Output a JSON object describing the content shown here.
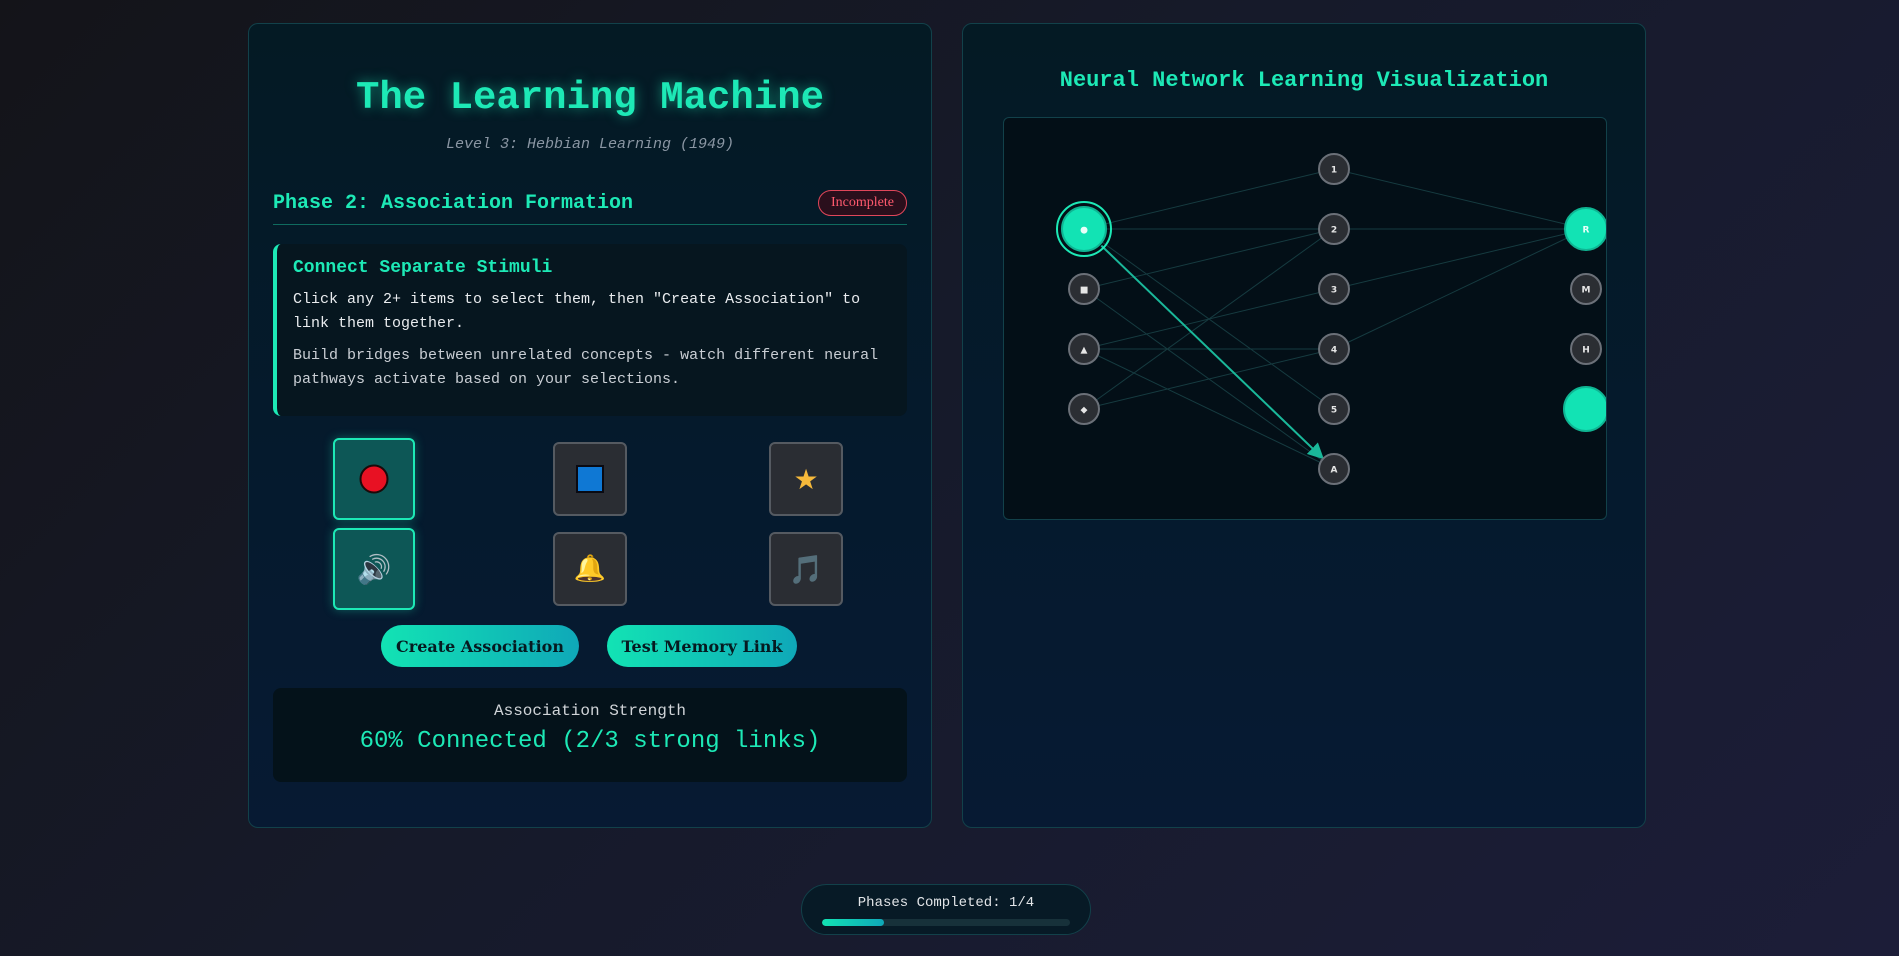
{
  "header": {
    "title": "The Learning Machine",
    "subtitle": "Level 3: Hebbian Learning (1949)"
  },
  "phase": {
    "title": "Phase 2: Association Formation",
    "status": "Incomplete"
  },
  "instructions": {
    "title": "Connect Separate Stimuli",
    "line1": "Click any 2+ items to select them, then \"Create Association\" to link them together.",
    "line2": "Build bridges between unrelated concepts - watch different neural pathways activate based on your selections."
  },
  "stimuli": [
    {
      "icon": "red-circle-icon",
      "selected": true
    },
    {
      "icon": "blue-square-icon",
      "selected": false
    },
    {
      "icon": "star-icon",
      "glyph": "★",
      "selected": false
    },
    {
      "icon": "speaker-icon",
      "glyph": "🔊",
      "selected": true
    },
    {
      "icon": "bell-icon",
      "glyph": "🔔",
      "selected": false
    },
    {
      "icon": "music-note-icon",
      "glyph": "🎵",
      "selected": false
    }
  ],
  "buttons": {
    "create_label": "Create Association",
    "test_label": "Test Memory Link"
  },
  "strength": {
    "label": "Association Strength",
    "value": "60% Connected (2/3 strong links)"
  },
  "visualization": {
    "title": "Neural Network Learning Visualization",
    "input_nodes": [
      "●",
      "■",
      "▲",
      "◆"
    ],
    "hidden_nodes": [
      "1",
      "2",
      "3",
      "4",
      "5",
      "A"
    ],
    "output_nodes": [
      "R",
      "M",
      "H",
      ""
    ],
    "active_inputs": [
      0
    ],
    "active_outputs": [
      0,
      3
    ],
    "highlight_connection": {
      "from": "input-0",
      "to": "hidden-5"
    }
  },
  "progress": {
    "label": "Phases Completed: 1/4",
    "fraction": 0.25
  },
  "colors": {
    "accent": "#1de9b6",
    "danger": "#ff5a6e",
    "red": "#e81123",
    "blue": "#0f78d4",
    "gold": "#f6b93b",
    "purple": "#7b61d6"
  }
}
